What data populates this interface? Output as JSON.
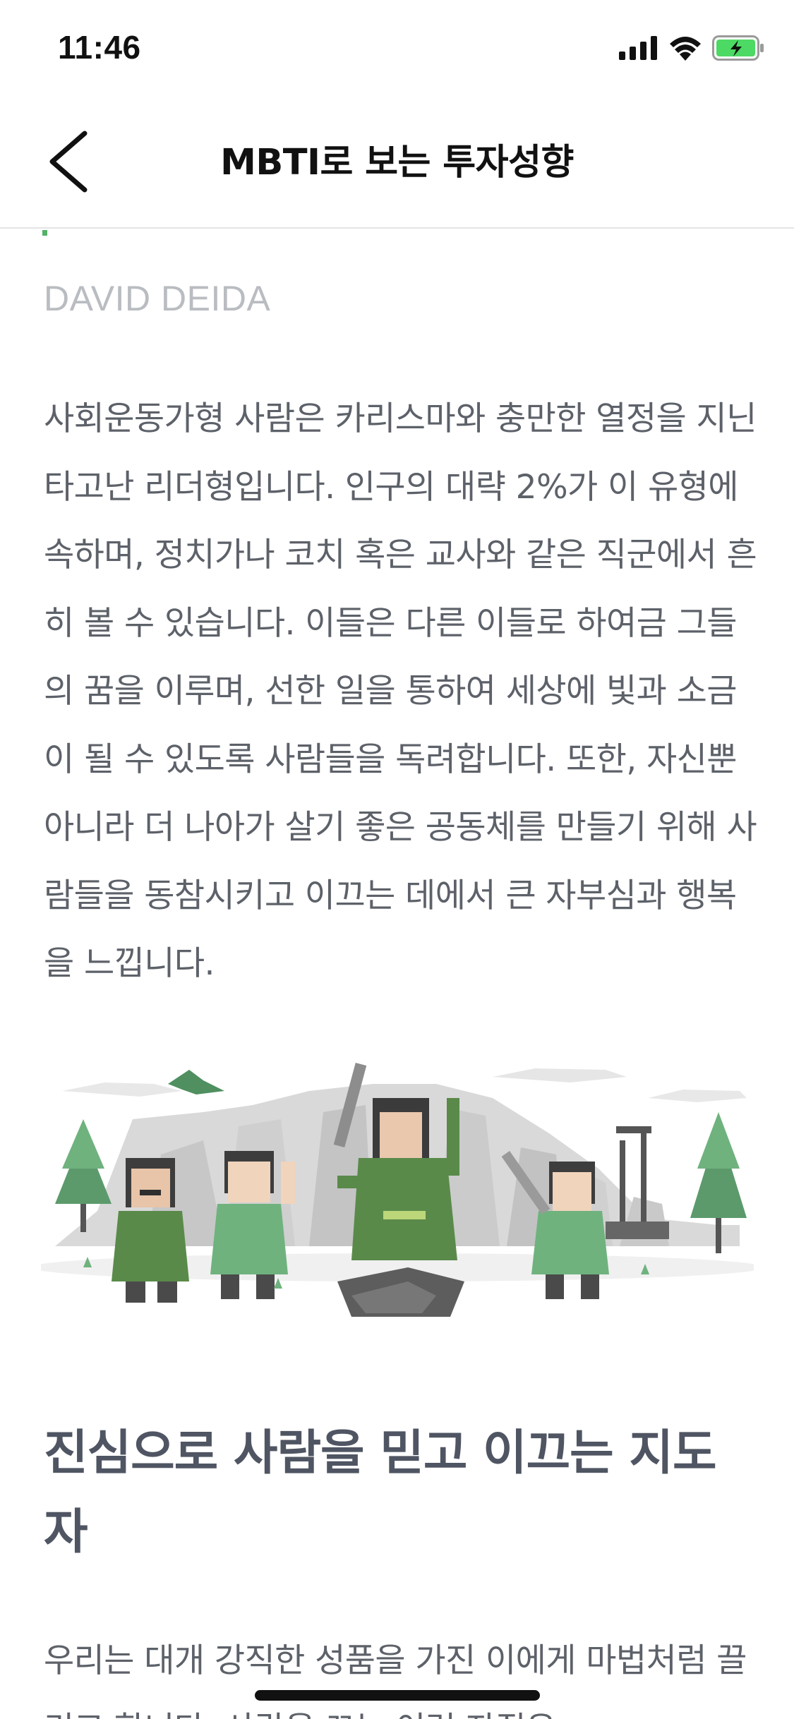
{
  "status_bar": {
    "time": "11:46",
    "icons": [
      "cellular-signal-icon",
      "wifi-icon",
      "battery-charging-icon"
    ],
    "battery_color": "#4cd964"
  },
  "nav": {
    "title": "MBTI로 보는 투자성향",
    "back_icon": "chevron-left-icon"
  },
  "article": {
    "accent_color": "#54b068",
    "author": "DAVID DEIDA",
    "paragraph_1": "사회운동가형 사람은 카리스마와 충만한 열정을 지닌 타고난 리더형입니다. 인구의 대략 2%가 이 유형에 속하며, 정치가나 코치 혹은 교사와 같은 직군에서 흔히 볼 수 있습니다. 이들은 다른 이들로 하여금 그들의 꿈을 이루며, 선한 일을 통하여 세상에 빛과 소금이 될 수 있도록 사람들을 독려합니다. 또한, 자신뿐 아니라 더 나아가 살기 좋은 공동체를 만들기 위해 사람들을 동참시키고 이끄는 데에서 큰 자부심과 행복을 느낍니다.",
    "illustration": "leader-characters-illustration",
    "heading": "진심으로 사람을 믿고 이끄는 지도자",
    "paragraph_2": "우리는 대개 강직한 성품을 가진 이에게 마법처럼 끌리고 합니다. 사람을 끄는 이런 자질은"
  }
}
